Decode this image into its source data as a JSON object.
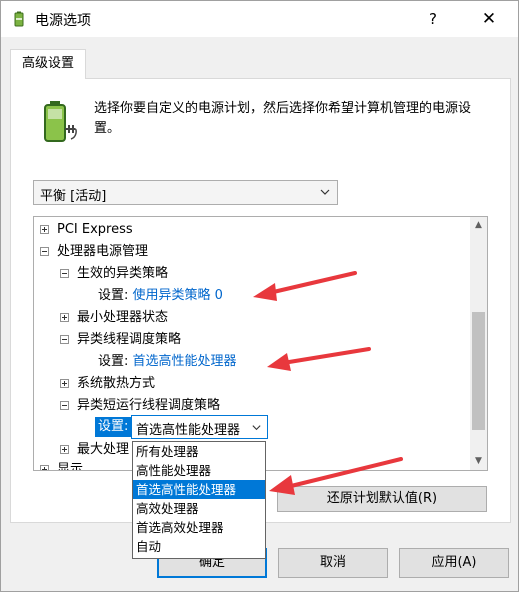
{
  "window": {
    "title": "电源选项",
    "help": "?",
    "close": "✕"
  },
  "tab": {
    "label": "高级设置"
  },
  "intro": "选择你要自定义的电源计划，然后选择你希望计算机管理的电源设置。",
  "plan": {
    "selected": "平衡 [活动]"
  },
  "tree": {
    "pci": "PCI Express",
    "cpu_mgmt": "处理器电源管理",
    "hetero_policy": "生效的异类策略",
    "hetero_policy_setting_label": "设置:",
    "hetero_policy_setting_value": "使用异类策略 0",
    "min_state": "最小处理器状态",
    "thread_sched": "异类线程调度策略",
    "thread_sched_setting_label": "设置:",
    "thread_sched_setting_value": "首选高性能处理器",
    "cooling": "系统散热方式",
    "short_thread_sched": "异类短运行线程调度策略",
    "short_setting_label": "设置:",
    "short_setting_value": "首选高性能处理器",
    "max_cpu": "最大处理",
    "display": "显示"
  },
  "dropdown": {
    "options": [
      "所有处理器",
      "高性能处理器",
      "首选高性能处理器",
      "高效处理器",
      "首选高效处理器",
      "自动"
    ],
    "selected_index": 2
  },
  "buttons": {
    "restore": "还原计划默认值(R)",
    "ok": "确定",
    "cancel": "取消",
    "apply": "应用(A)"
  },
  "colors": {
    "accent": "#0078d7",
    "link": "#0066cc",
    "annotation_arrow": "#e8383d"
  }
}
